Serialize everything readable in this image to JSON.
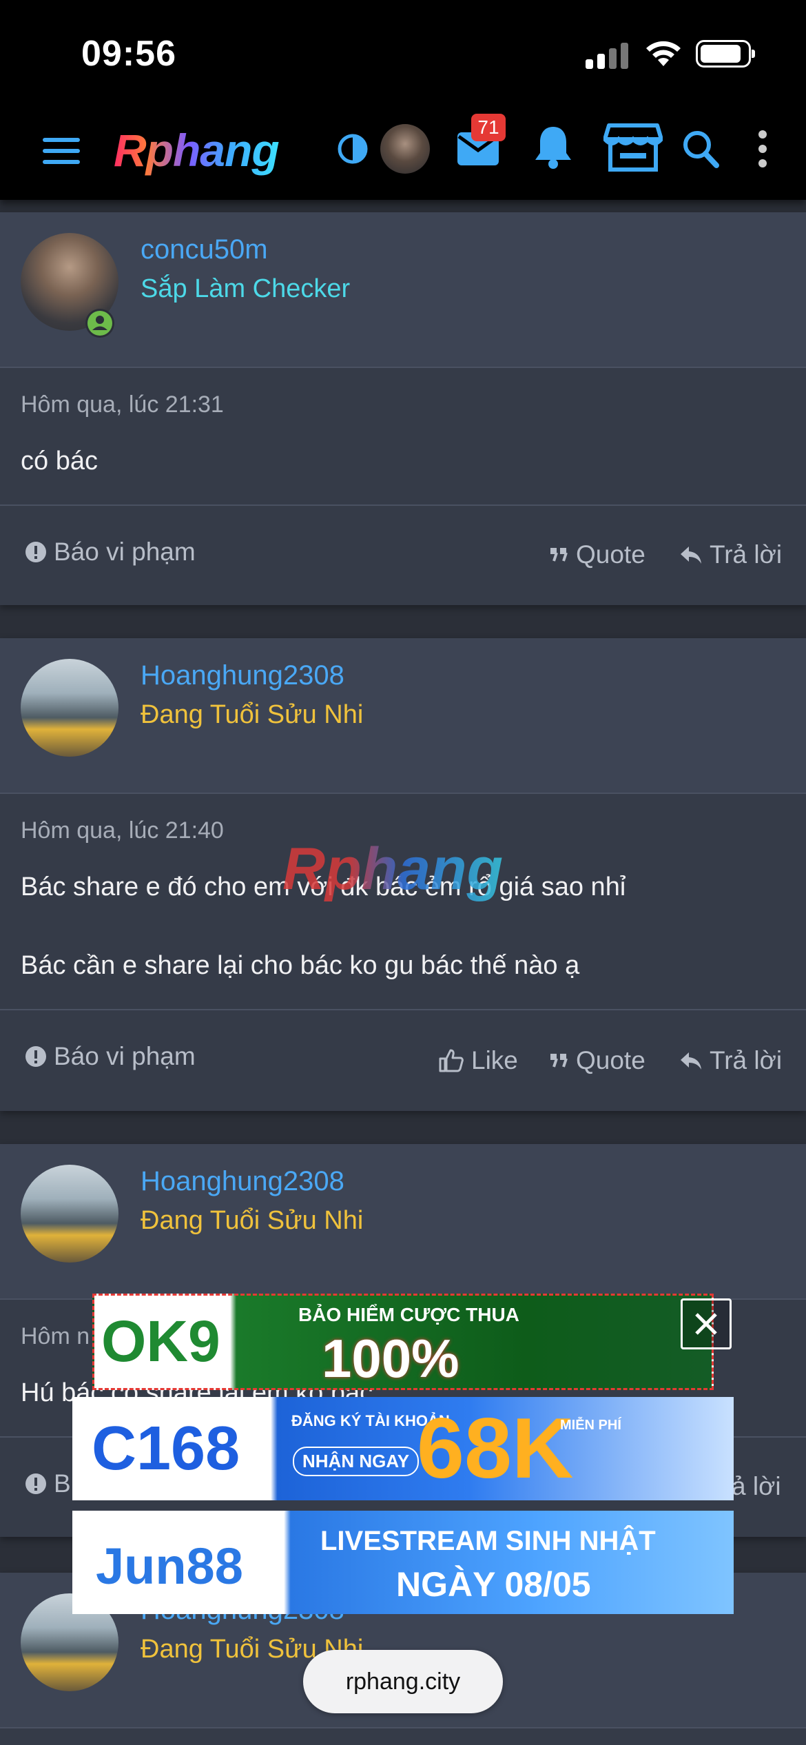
{
  "status_bar": {
    "time": "09:56"
  },
  "nav": {
    "logo": "Rphang",
    "inbox_badge": "71",
    "accent_color": "#3fa9f5"
  },
  "posts": [
    {
      "username": "concu50m",
      "user_title": "Sắp Làm Checker",
      "user_title_color": "#4dd9e8",
      "timestamp": "Hôm qua, lúc 21:31",
      "body": [
        "có bác"
      ],
      "actions": {
        "report": "Báo vi phạm",
        "quote": "Quote",
        "reply": "Trả lời"
      }
    },
    {
      "username": "Hoanghung2308",
      "user_title": "Đang Tuổi Sửu Nhi",
      "user_title_color": "#f0c23c",
      "timestamp": "Hôm qua, lúc 21:40",
      "body": [
        "Bác share e đó cho em với đk bác ẻm rổ giá sao nhỉ",
        "Bác cần e share lại cho bác ko gu bác thế nào ạ"
      ],
      "actions": {
        "report": "Báo vi phạm",
        "like": "Like",
        "quote": "Quote",
        "reply": "Trả lời"
      }
    },
    {
      "username": "Hoanghung2308",
      "user_title": "Đang Tuổi Sửu Nhi",
      "user_title_color": "#f0c23c",
      "timestamp_partial": "Hôm n",
      "body_partial": "Hú bác có share lại em ko bác",
      "actions": {
        "report_partial": "B",
        "reply_partial": "ả lời"
      }
    },
    {
      "username": "Hoanghung2308",
      "user_title": "Đang Tuổi Sửu Nhi",
      "user_title_color": "#f0c23c"
    }
  ],
  "watermark": "Rphang",
  "ads": {
    "ok9": {
      "brand": "OK9",
      "headline": "BẢO HIỂM CƯỢC THUA",
      "value": "100%"
    },
    "c168": {
      "brand": "C168",
      "line1": "ĐĂNG KÝ TÀI KHOẢN",
      "line2": "NHẬN NGAY",
      "value": "68K",
      "tag": "MIỄN PHÍ"
    },
    "jun88": {
      "brand": "Jun88",
      "line1": "LIVESTREAM SINH NHẬT",
      "line2": "NGÀY 08/05"
    }
  },
  "browser": {
    "url": "rphang.city"
  }
}
